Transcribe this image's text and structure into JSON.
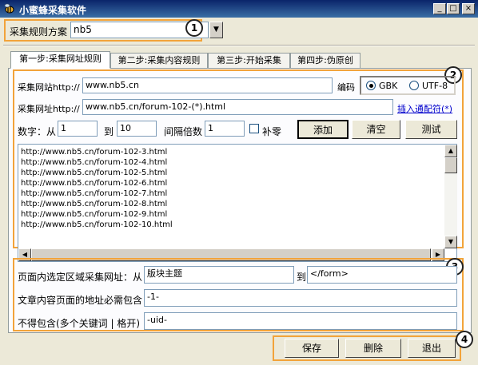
{
  "window": {
    "title": "小蜜蜂采集软件",
    "minimize": "_",
    "maximize": "□",
    "close": "×"
  },
  "scheme": {
    "label": "采集规则方案",
    "value": "nb5",
    "dropdown": "▼",
    "badge": "1"
  },
  "tabs": [
    {
      "label": "第一步:采集网址规则"
    },
    {
      "label": "第二步:采集内容规则"
    },
    {
      "label": "第三步:开始采集"
    },
    {
      "label": "第四步:伪原创"
    }
  ],
  "step1": {
    "badge": "2",
    "site_label": "采集网站http://",
    "site_value": "www.nb5.cn",
    "encoding_label": "编码",
    "gbk": "GBK",
    "utf8": "UTF-8",
    "url_label": "采集网址http://",
    "url_value": "www.nb5.cn/forum-102-(*).html",
    "insert_wildcard": "插入通配符(*)",
    "number_label": "数字：从",
    "from_value": "1",
    "to_label": "到",
    "to_value": "10",
    "step_label": "间隔倍数",
    "step_value": "1",
    "pad_zero": "补零",
    "add": "添加",
    "clear": "清空",
    "test": "测试",
    "urls": [
      "http://www.nb5.cn/forum-102-3.html",
      "http://www.nb5.cn/forum-102-4.html",
      "http://www.nb5.cn/forum-102-5.html",
      "http://www.nb5.cn/forum-102-6.html",
      "http://www.nb5.cn/forum-102-7.html",
      "http://www.nb5.cn/forum-102-8.html",
      "http://www.nb5.cn/forum-102-9.html",
      "http://www.nb5.cn/forum-102-10.html"
    ]
  },
  "filter": {
    "badge": "3",
    "region_label": "页面内选定区域采集网址：从",
    "region_from": "版块主题",
    "region_to_label": "到",
    "region_to": "</form>",
    "must_contain_label": "文章内容页面的地址必需包含",
    "must_contain": "-1-",
    "exclude_label": "不得包含(多个关键词 | 格开)",
    "exclude": "-uid-"
  },
  "footer": {
    "badge": "4",
    "save": "保存",
    "delete": "删除",
    "exit": "退出"
  },
  "colors": {
    "accent": "#f2a33a",
    "titlebar": "#0a246a"
  }
}
